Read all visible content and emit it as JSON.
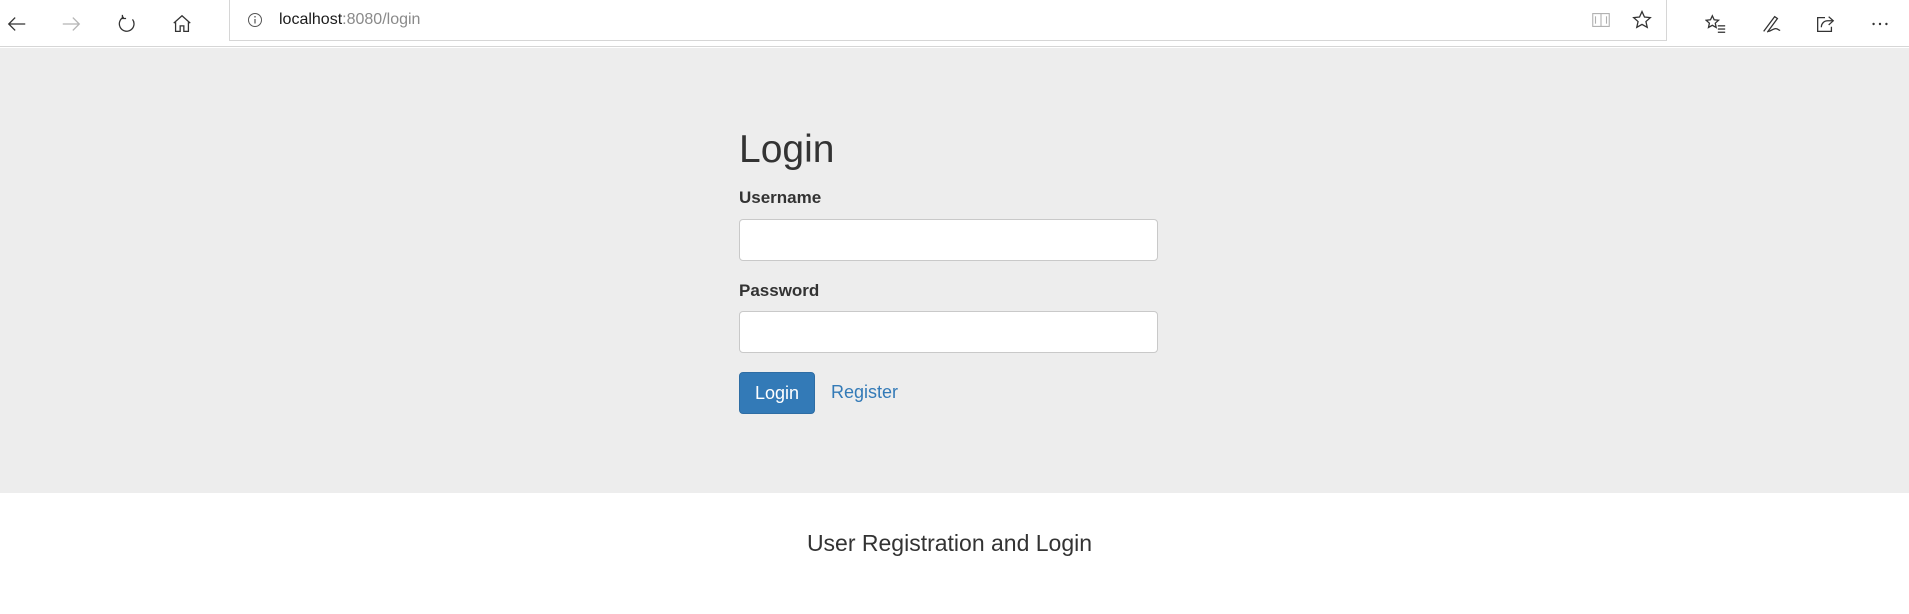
{
  "browser": {
    "url_host": "localhost",
    "url_rest": ":8080/login",
    "icons": {
      "back": "back-arrow-icon",
      "forward": "forward-arrow-icon",
      "refresh": "refresh-icon",
      "home": "home-icon",
      "info": "info-icon",
      "reading_view": "reading-view-icon",
      "favorite": "star-icon",
      "favorites_list": "favorites-list-icon",
      "notes": "pen-icon",
      "share": "share-icon",
      "more": "more-icon"
    }
  },
  "login": {
    "title": "Login",
    "username_label": "Username",
    "username_value": "",
    "password_label": "Password",
    "password_value": "",
    "login_button": "Login",
    "register_link": "Register"
  },
  "footer": {
    "text": "User Registration and Login"
  },
  "colors": {
    "primary": "#337ab7",
    "hero_bg": "#ededed"
  }
}
